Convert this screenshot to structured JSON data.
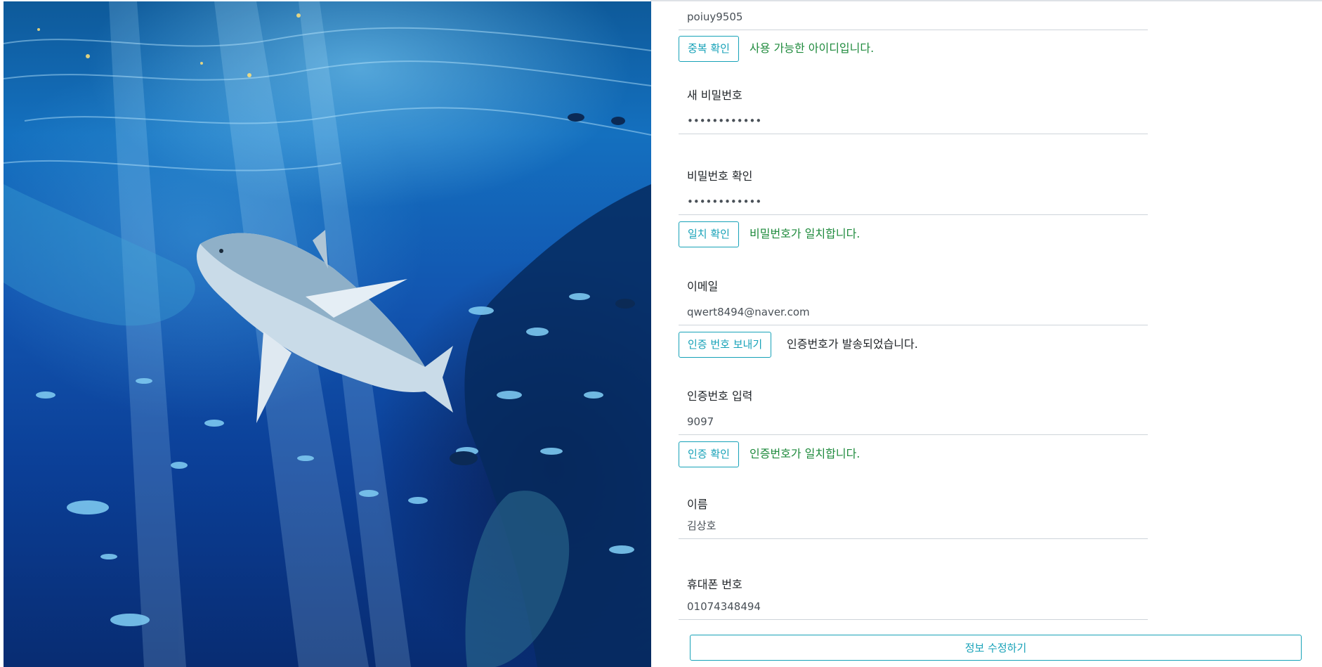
{
  "form": {
    "user_id": {
      "value": "poiuy9505"
    },
    "dup_check": {
      "button": "중복 확인",
      "message": "사용 가능한 아이디입니다."
    },
    "new_password": {
      "label": "새 비밀번호",
      "value": "••••••••••••"
    },
    "password_confirm": {
      "label": "비밀번호 확인",
      "value": "••••••••••••"
    },
    "match_check": {
      "button": "일치 확인",
      "message": "비밀번호가 일치합니다."
    },
    "email": {
      "label": "이메일",
      "value": "qwert8494@naver.com"
    },
    "send_code": {
      "button": "인증 번호 보내기",
      "message": "인증번호가 발송되었습니다."
    },
    "code_input": {
      "label": "인증번호 입력",
      "value": "9097"
    },
    "code_check": {
      "button": "인증 확인",
      "message": "인증번호가 일치합니다."
    },
    "name": {
      "label": "이름",
      "value": "김상호"
    },
    "phone": {
      "label": "휴대폰 번호",
      "value": "01074348494"
    },
    "submit": {
      "label": "정보 수정하기"
    }
  },
  "colors": {
    "accent": "#17a2b8",
    "success": "#1e8a3c",
    "ocean_dark": "#082c72",
    "ocean_light": "#1470bf"
  },
  "hero": {
    "icon": "shark-aquarium-image"
  }
}
